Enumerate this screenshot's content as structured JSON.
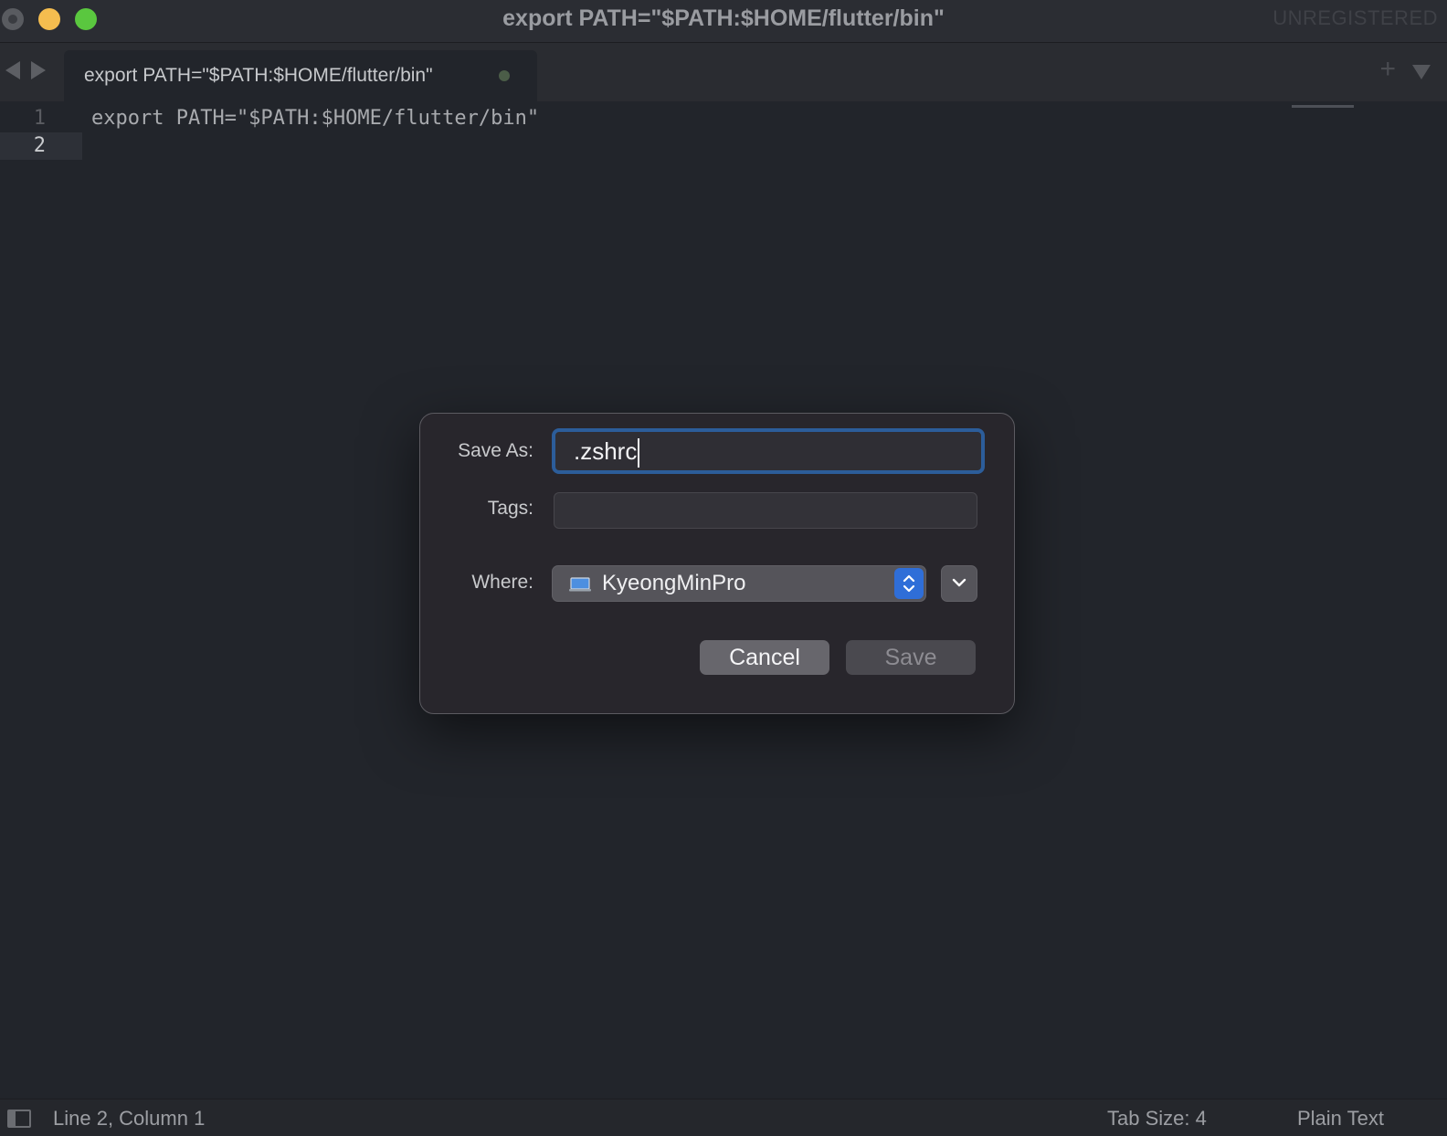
{
  "window": {
    "title": "export PATH=\"$PATH:$HOME/flutter/bin\"",
    "registration": "UNREGISTERED"
  },
  "tabs": [
    {
      "label": "export PATH=\"$PATH:$HOME/flutter/bin\"",
      "modified": true
    }
  ],
  "editor": {
    "lines": [
      {
        "number": "1",
        "text": "export PATH=\"$PATH:$HOME/flutter/bin\""
      },
      {
        "number": "2",
        "text": ""
      }
    ]
  },
  "save_dialog": {
    "save_as_label": "Save As:",
    "save_as_value": ".zshrc",
    "tags_label": "Tags:",
    "tags_value": "",
    "where_label": "Where:",
    "where_value": "KyeongMinPro",
    "cancel_label": "Cancel",
    "save_label": "Save"
  },
  "status_bar": {
    "position": "Line 2, Column 1",
    "tab_size": "Tab Size: 4",
    "syntax": "Plain Text"
  },
  "colors": {
    "accent_focus": "#2c5d9a",
    "stepper_blue": "#2f6ed8",
    "traffic_minimize": "#f5bd4f",
    "traffic_maximize": "#5ac73f"
  }
}
